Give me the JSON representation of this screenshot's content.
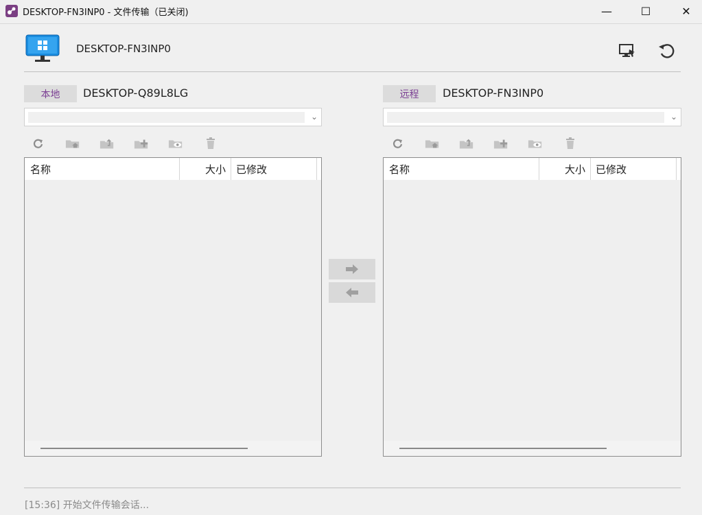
{
  "window": {
    "title": "DESKTOP-FN3INP0 - 文件传输（已关闭)",
    "minimize": "—",
    "maximize": "☐",
    "close": "✕"
  },
  "header": {
    "remote_host": "DESKTOP-FN3INP0",
    "icons": [
      "monitor-windows-icon",
      "remote-control-icon",
      "reconnect-icon"
    ]
  },
  "local": {
    "tag": "本地",
    "host": "DESKTOP-Q89L8LG",
    "path": "",
    "toolbar": [
      "refresh-icon",
      "home-folder-icon",
      "parent-folder-icon",
      "new-folder-icon",
      "preview-icon",
      "delete-icon"
    ],
    "columns": {
      "name": "名称",
      "size": "大小",
      "modified": "已修改"
    }
  },
  "remote": {
    "tag": "远程",
    "host": "DESKTOP-FN3INP0",
    "path": "",
    "toolbar": [
      "refresh-icon",
      "home-folder-icon",
      "parent-folder-icon",
      "new-folder-icon",
      "preview-icon",
      "delete-icon"
    ],
    "columns": {
      "name": "名称",
      "size": "大小",
      "modified": "已修改"
    }
  },
  "transfer": {
    "send_icon": "arrow-right-icon",
    "receive_icon": "arrow-left-icon"
  },
  "status": {
    "text": "[15:36] 开始文件传输会话..."
  },
  "colors": {
    "accent": "#7b3f93",
    "background": "#f0f0f0"
  }
}
